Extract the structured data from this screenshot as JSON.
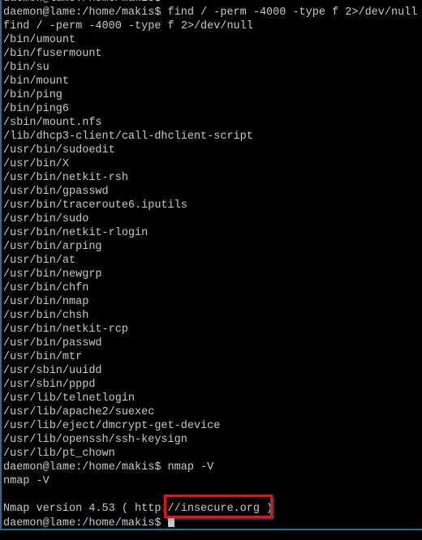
{
  "terminal": {
    "lines": [
      "daemon@lame:/home/makis$",
      "daemon@lame:/home/makis$ find / -perm -4000 -type f 2>/dev/null",
      "find / -perm -4000 -type f 2>/dev/null",
      "/bin/umount",
      "/bin/fusermount",
      "/bin/su",
      "/bin/mount",
      "/bin/ping",
      "/bin/ping6",
      "/sbin/mount.nfs",
      "/lib/dhcp3-client/call-dhclient-script",
      "/usr/bin/sudoedit",
      "/usr/bin/X",
      "/usr/bin/netkit-rsh",
      "/usr/bin/gpasswd",
      "/usr/bin/traceroute6.iputils",
      "/usr/bin/sudo",
      "/usr/bin/netkit-rlogin",
      "/usr/bin/arping",
      "/usr/bin/at",
      "/usr/bin/newgrp",
      "/usr/bin/chfn",
      "/usr/bin/nmap",
      "/usr/bin/chsh",
      "/usr/bin/netkit-rcp",
      "/usr/bin/passwd",
      "/usr/bin/mtr",
      "/usr/sbin/uuidd",
      "/usr/sbin/pppd",
      "/usr/lib/telnetlogin",
      "/usr/lib/apache2/suexec",
      "/usr/lib/eject/dmcrypt-get-device",
      "/usr/lib/openssh/ssh-keysign",
      "/usr/lib/pt_chown",
      "daemon@lame:/home/makis$ nmap -V",
      "nmap -V",
      "",
      "Nmap version 4.53 ( http://insecure.org )"
    ],
    "prompt": "daemon@lame:/home/makis$ ",
    "colors": {
      "text": "#c8c8c8",
      "background": "#000000",
      "border": "#2a6f8f",
      "highlight": "#e0141a"
    }
  }
}
